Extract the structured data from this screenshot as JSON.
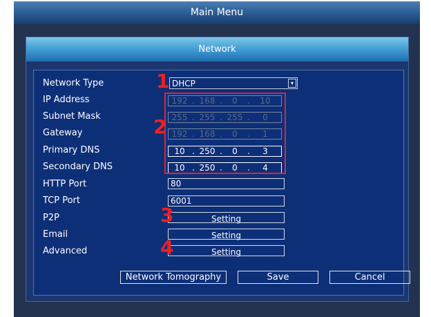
{
  "main_menu": {
    "title": "Main Menu"
  },
  "network_dialog": {
    "title": "Network"
  },
  "network_type": {
    "label": "Network Type",
    "value": "DHCP",
    "arrow": "▾"
  },
  "ip_fields": [
    {
      "label": "IP Address",
      "octets": [
        "192",
        "168",
        "0",
        "10"
      ],
      "enabled": false
    },
    {
      "label": "Subnet Mask",
      "octets": [
        "255",
        "255",
        "255",
        "0"
      ],
      "enabled": false
    },
    {
      "label": "Gateway",
      "octets": [
        "192",
        "168",
        "0",
        "1"
      ],
      "enabled": false
    },
    {
      "label": "Primary DNS",
      "octets": [
        "10",
        "250",
        "0",
        "3"
      ],
      "enabled": true
    },
    {
      "label": "Secondary DNS",
      "octets": [
        "10",
        "250",
        "0",
        "4"
      ],
      "enabled": true
    }
  ],
  "http_port": {
    "label": "HTTP Port",
    "value": "80"
  },
  "tcp_port": {
    "label": "TCP Port",
    "value": "6001"
  },
  "p2p": {
    "label": "P2P",
    "button": "Setting"
  },
  "email": {
    "label": "Email",
    "button": "Setting"
  },
  "advanced": {
    "label": "Advanced",
    "button": "Setting"
  },
  "buttons": {
    "network_tomography": "Network Tomography",
    "save": "Save",
    "cancel": "Cancel"
  },
  "annotations": {
    "marker_1": "1",
    "marker_2": "2",
    "marker_3": "3",
    "marker_4": "4"
  },
  "colors": {
    "annotation_red": "#e62330",
    "panel_blue": "#0d2f78",
    "header_blue": "#48a3d7"
  }
}
